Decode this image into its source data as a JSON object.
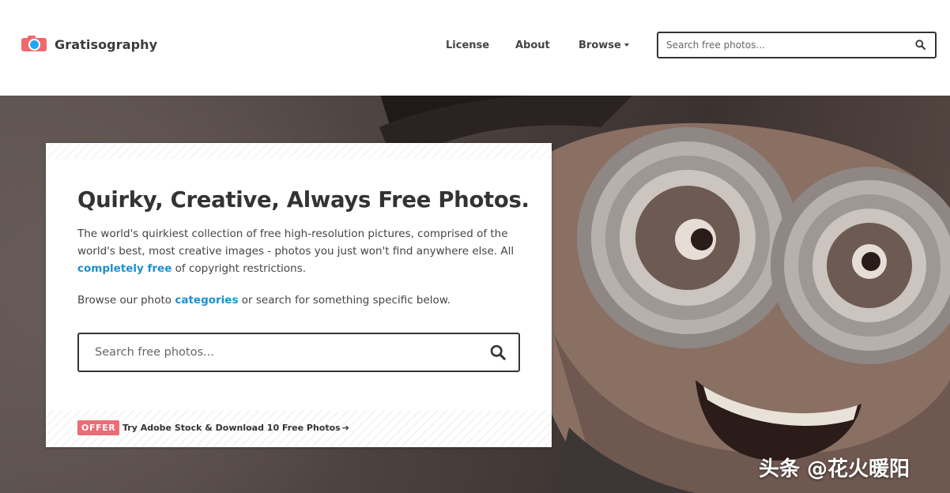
{
  "header": {
    "logo_text": "Gratisography",
    "nav": {
      "license": "License",
      "about": "About",
      "browse": "Browse"
    },
    "search": {
      "placeholder": "Search free photos..."
    }
  },
  "hero": {
    "title": "Quirky, Creative, Always Free Photos.",
    "description_part1": "The world's quirkiest collection of free high-resolution pictures, comprised of the world's best, most creative images - photos you just won't find anywhere else. All ",
    "description_link": "completely free",
    "description_part2": " of copyright restrictions.",
    "browse_part1": "Browse our photo ",
    "browse_link": "categories",
    "browse_part2": " or search for something specific below.",
    "search": {
      "placeholder": "Search free photos..."
    },
    "offer": {
      "badge": "OFFER",
      "link_text": "Try Adobe Stock & Download 10 Free Photos"
    }
  },
  "watermark": "头条 @花火暖阳",
  "colors": {
    "brand_red": "#ee6a6f",
    "brand_blue": "#22a7f0",
    "link_blue": "#1d8fcf",
    "offer_badge": "#ec6b76"
  },
  "icons": {
    "logo": "camera-logo-icon",
    "search": "search-icon",
    "browse_caret": "caret-down-icon",
    "offer_arrow": "arrow-right-icon"
  }
}
